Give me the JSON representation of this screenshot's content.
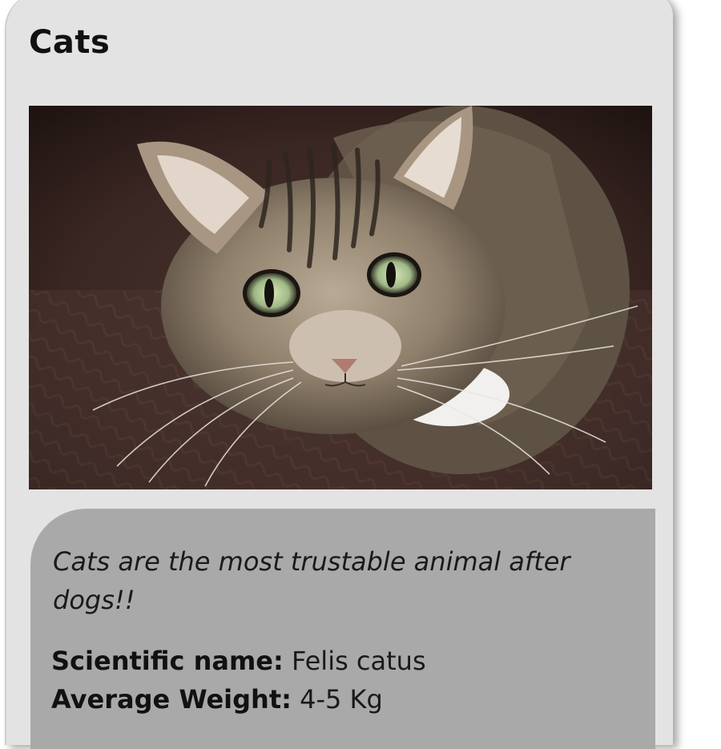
{
  "card": {
    "title": "Cats",
    "image": {
      "subject": "tabby cat looking up, green eyes, on dark brown blanket"
    },
    "info": {
      "tagline": "Cats are the most trustable animal after dogs!!",
      "facts": [
        {
          "label": "Scientific name",
          "value": "Felis catus"
        },
        {
          "label": "Average Weight",
          "value": "4-5 Kg"
        }
      ]
    }
  },
  "colors": {
    "card_bg": "#e3e3e3",
    "info_bg": "#a9a9a9",
    "text": "#1a1a1a"
  }
}
